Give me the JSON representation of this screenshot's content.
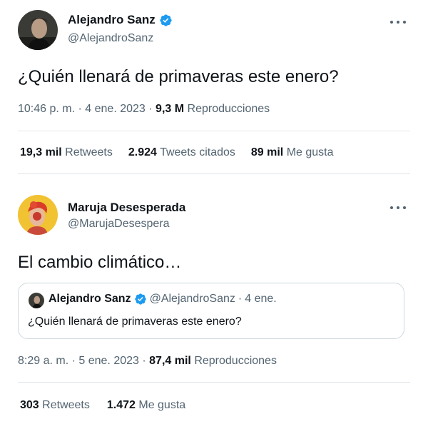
{
  "tweet1": {
    "author": {
      "display_name": "Alejandro Sanz",
      "handle": "@AlejandroSanz",
      "verified": true
    },
    "text": "¿Quién llenará de primaveras este enero?",
    "time": "10:46 p. m.",
    "date": "4 ene. 2023",
    "views_count": "9,3 M",
    "views_label": "Reproducciones",
    "stats": {
      "retweets_count": "19,3 mil",
      "retweets_label": "Retweets",
      "quotes_count": "2.924",
      "quotes_label": "Tweets citados",
      "likes_count": "89 mil",
      "likes_label": "Me gusta"
    }
  },
  "tweet2": {
    "author": {
      "display_name": "Maruja Desesperada",
      "handle": "@MarujaDesespera",
      "verified": false
    },
    "text": "El cambio climático…",
    "quoted": {
      "display_name": "Alejandro Sanz",
      "handle": "@AlejandroSanz",
      "separator": "·",
      "date": "4 ene.",
      "text": "¿Quién llenará de primaveras este enero?"
    },
    "time": "8:29 a. m.",
    "date": "5 ene. 2023",
    "views_count": "87,4 mil",
    "views_label": "Reproducciones",
    "stats": {
      "retweets_count": "303",
      "retweets_label": "Retweets",
      "likes_count": "1.472",
      "likes_label": "Me gusta"
    }
  },
  "separator": "·",
  "colors": {
    "verified": "#1d9bf0",
    "secondary_text": "#536471",
    "primary_text": "#0f1419",
    "divider": "#e1e6ea"
  },
  "icons": [
    "verified-badge-icon",
    "more-options-icon"
  ]
}
